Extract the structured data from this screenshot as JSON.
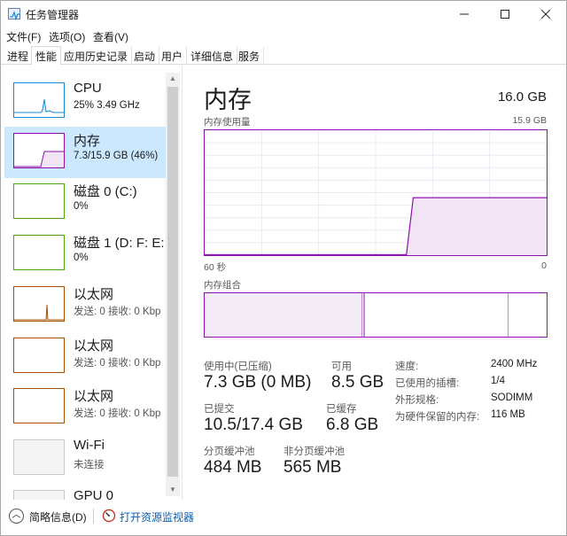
{
  "window": {
    "title": "任务管理器"
  },
  "menu": [
    "文件(F)",
    "选项(O)",
    "查看(V)"
  ],
  "tabs": [
    "进程",
    "性能",
    "应用历史记录",
    "启动",
    "用户",
    "详细信息",
    "服务"
  ],
  "active_tab": "性能",
  "sidebar": [
    {
      "name": "CPU",
      "sub": "25%  3.49 GHz",
      "color": "#1a8ad4"
    },
    {
      "name": "内存",
      "sub": "7.3/15.9 GB (46%)",
      "color": "#8b12ae",
      "selected": true
    },
    {
      "name": "磁盘 0 (C:)",
      "sub": "0%",
      "color": "#4da60c"
    },
    {
      "name": "磁盘 1 (D: F: E:",
      "sub": "0%",
      "color": "#4da60c"
    },
    {
      "name": "以太网",
      "sub": "发送: 0 接收: 0 Kbp",
      "color": "#a74f01"
    },
    {
      "name": "以太网",
      "sub": "发送: 0 接收: 0 Kbp",
      "color": "#a74f01"
    },
    {
      "name": "以太网",
      "sub": "发送: 0 接收: 0 Kbp",
      "color": "#a74f01"
    },
    {
      "name": "Wi-Fi",
      "sub": "未连接",
      "color": "#a7a7a7"
    },
    {
      "name": "GPU 0",
      "sub": "",
      "color": "#a7a7a7"
    }
  ],
  "main": {
    "title": "内存",
    "total": "16.0 GB",
    "usage_label": "内存使用量",
    "usage_max": "15.9 GB",
    "time_left": "60 秒",
    "time_right": "0",
    "composition_label": "内存组合",
    "usage_level": 0.46,
    "accent": "#8b12ae"
  },
  "stats": {
    "in_use_label": "使用中(已压缩)",
    "in_use_value": "7.3 GB (0 MB)",
    "available_label": "可用",
    "available_value": "8.5 GB",
    "committed_label": "已提交",
    "committed_value": "10.5/17.4 GB",
    "cached_label": "已缓存",
    "cached_value": "6.8 GB",
    "paged_label": "分页缓冲池",
    "paged_value": "484 MB",
    "nonpaged_label": "非分页缓冲池",
    "nonpaged_value": "565 MB"
  },
  "details": [
    {
      "label": "速度:",
      "value": "2400 MHz"
    },
    {
      "label": "已使用的插槽:",
      "value": "1/4"
    },
    {
      "label": "外形规格:",
      "value": "SODIMM"
    },
    {
      "label": "为硬件保留的内存:",
      "value": "116 MB"
    }
  ],
  "footer": {
    "brief": "简略信息(D)",
    "monitor": "打开资源监视器"
  }
}
